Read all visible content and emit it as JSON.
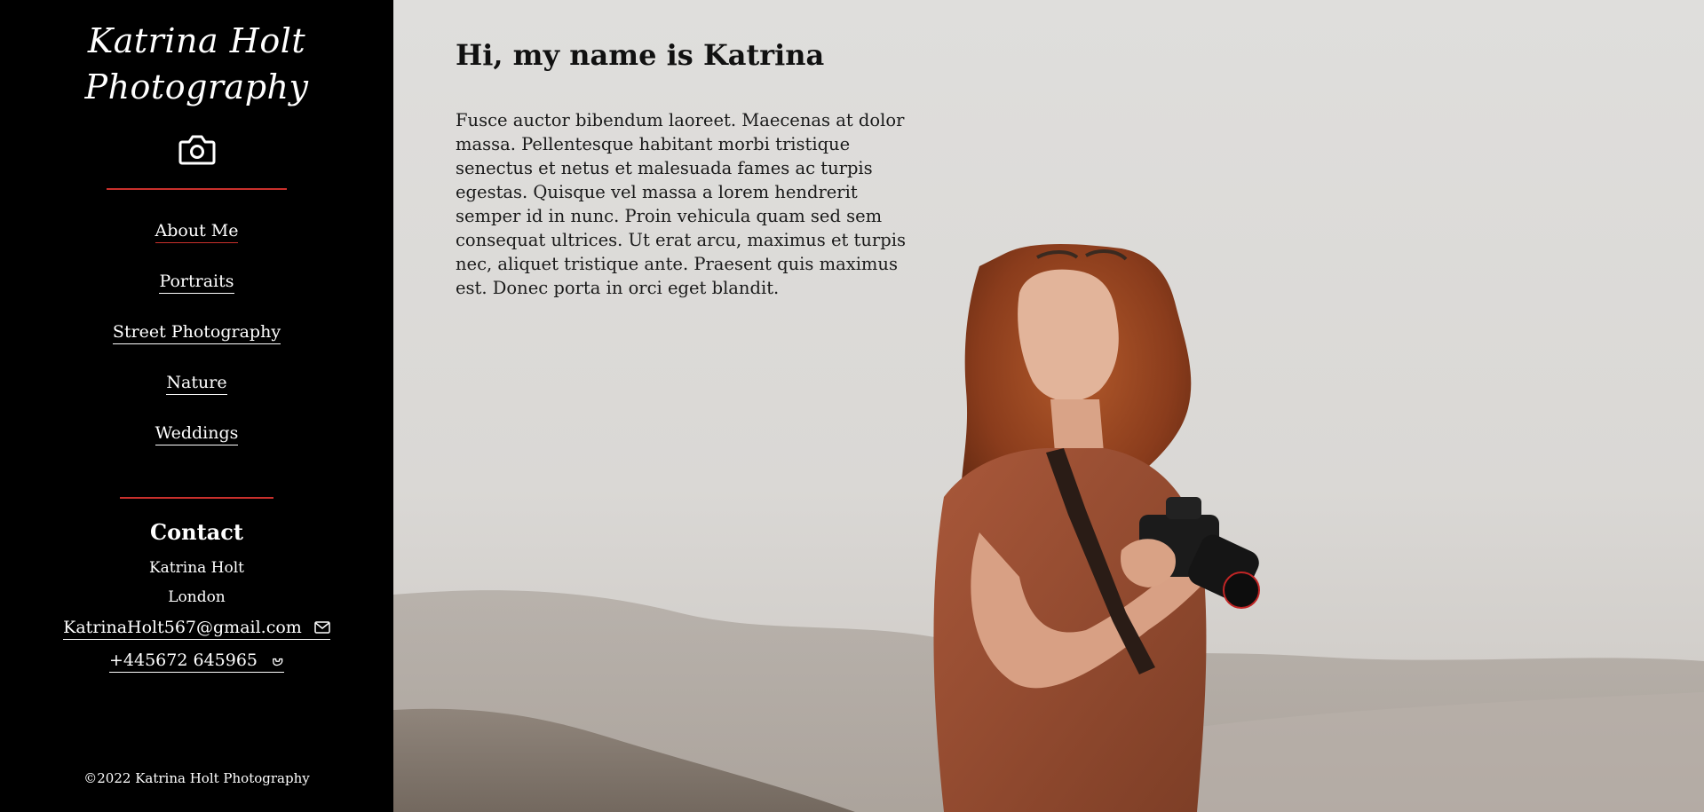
{
  "brand": {
    "line1": "Katrina Holt",
    "line2": "Photography"
  },
  "icons": {
    "brand_icon": "camera-icon",
    "email_icon": "envelope-icon",
    "phone_icon": "phone-icon"
  },
  "colors": {
    "sidebar_bg": "#000000",
    "accent": "#c9302c",
    "text_light": "#ffffff",
    "text_dark": "#111111"
  },
  "nav": {
    "items": [
      {
        "label": "About Me",
        "active": true
      },
      {
        "label": "Portraits",
        "active": false
      },
      {
        "label": "Street Photography",
        "active": false
      },
      {
        "label": "Nature",
        "active": false
      },
      {
        "label": "Weddings",
        "active": false
      }
    ]
  },
  "contact": {
    "title": "Contact",
    "name": "Katrina Holt",
    "city": "London",
    "email": "KatrinaHolt567@gmail.com",
    "phone": "+445672 645965"
  },
  "footer": {
    "copyright": "©2022 Katrina Holt Photography"
  },
  "hero": {
    "heading": "Hi, my name is Katrina",
    "body": "Fusce auctor bibendum laoreet. Maecenas at dolor massa. Pellentesque habitant morbi tristique senectus et netus et malesuada fames ac turpis egestas. Quisque vel massa a lorem hendrerit semper id in nunc. Proin vehicula quam sed sem consequat ultrices. Ut erat arcu, maximus et turpis nec, aliquet tristique ante. Praesent quis maximus est. Donec porta in orci eget blandit."
  }
}
